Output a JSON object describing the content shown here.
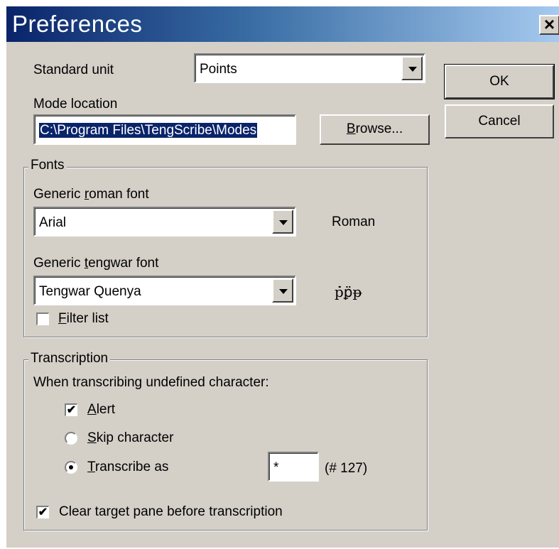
{
  "window": {
    "title": "Preferences",
    "close_glyph": "✕"
  },
  "general": {
    "standard_unit_label": "Standard unit",
    "standard_unit_value": "Points",
    "mode_location_label": "Mode location",
    "mode_location_value": "C:\\Program Files\\TengScribe\\Modes",
    "browse_label_u": "B",
    "browse_label_rest": "rowse..."
  },
  "buttons": {
    "ok": "OK",
    "cancel": "Cancel"
  },
  "fonts": {
    "group_title": "Fonts",
    "roman_label_pre": "Generic ",
    "roman_label_u": "r",
    "roman_label_post": "oman font",
    "roman_font_value": "Arial",
    "roman_sample": "Roman",
    "tengwar_label_pre": "Generic ",
    "tengwar_label_u": "t",
    "tengwar_label_post": "engwar font",
    "tengwar_font_value": "Tengwar Quenya",
    "tengwar_sample": "ṗ̇ꝑ̈ᵽ",
    "filter_list_u": "F",
    "filter_list_rest": "ilter list",
    "filter_list_checked": false
  },
  "transcription": {
    "group_title": "Transcription",
    "prompt": "When transcribing undefined character:",
    "alert_u": "A",
    "alert_rest": "lert",
    "alert_checked": true,
    "skip_u": "S",
    "skip_rest": "kip character",
    "skip_selected": false,
    "transcribe_as_u": "T",
    "transcribe_as_rest": "ranscribe as",
    "transcribe_as_selected": true,
    "transcribe_char_value": "*",
    "transcribe_char_code": "(# 127)",
    "clear_target_label": "Clear target pane before transcription",
    "clear_target_checked": true
  },
  "icons": {
    "checkmark": "✔"
  }
}
